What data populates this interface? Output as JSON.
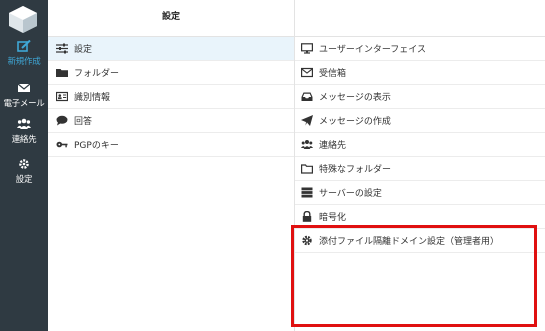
{
  "nav": {
    "compose": "新規作成",
    "mail": "電子メール",
    "contacts": "連絡先",
    "settings": "設定"
  },
  "settings_column": {
    "header": "設定",
    "items": [
      {
        "label": "設定",
        "icon": "sliders-icon"
      },
      {
        "label": "フォルダー",
        "icon": "folder-icon"
      },
      {
        "label": "識別情報",
        "icon": "id-card-icon"
      },
      {
        "label": "回答",
        "icon": "comment-icon"
      },
      {
        "label": "PGPのキー",
        "icon": "key-icon"
      }
    ]
  },
  "preferences_column": {
    "header": "",
    "items": [
      {
        "label": "ユーザーインターフェイス",
        "icon": "monitor-icon"
      },
      {
        "label": "受信箱",
        "icon": "envelope-icon"
      },
      {
        "label": "メッセージの表示",
        "icon": "inbox-icon"
      },
      {
        "label": "メッセージの作成",
        "icon": "paper-plane-icon"
      },
      {
        "label": "連絡先",
        "icon": "users-icon"
      },
      {
        "label": "特殊なフォルダー",
        "icon": "folder-icon"
      },
      {
        "label": "サーバーの設定",
        "icon": "server-icon"
      },
      {
        "label": "暗号化",
        "icon": "lock-icon"
      },
      {
        "label": "添付ファイル隔離ドメイン設定（管理者用）",
        "icon": "gear-icon"
      }
    ]
  },
  "colors": {
    "sidebar_bg": "#2f3a42",
    "accent": "#3fa7d6",
    "selected_row": "#e9f4fb",
    "highlight_border": "#e01010"
  }
}
